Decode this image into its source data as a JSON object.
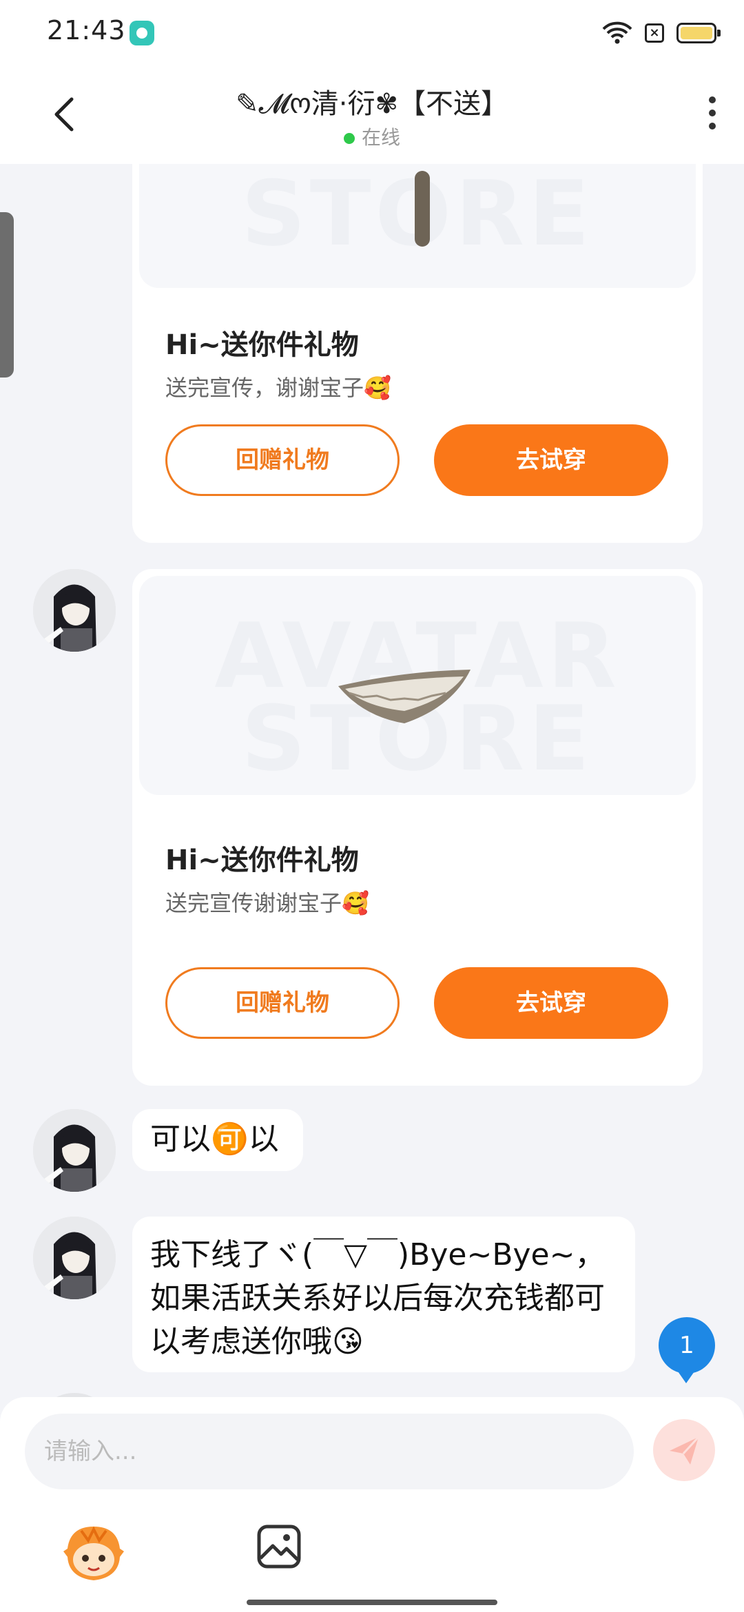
{
  "status_bar": {
    "time": "21:43"
  },
  "header": {
    "title": "✎𝓜ო清·衍✾【不送】",
    "status": "在线"
  },
  "messages": [
    {
      "type": "gift",
      "title": "Hi~送你件礼物",
      "subtitle": "送完宣传，谢谢宝子🥰",
      "reply_label": "回赠礼物",
      "try_label": "去试穿"
    },
    {
      "type": "gift",
      "title": "Hi~送你件礼物",
      "subtitle": "送完宣传谢谢宝子🥰",
      "reply_label": "回赠礼物",
      "try_label": "去试穿"
    },
    {
      "type": "text",
      "text": "可以🉑以"
    },
    {
      "type": "text",
      "text": "我下线了ヾ(￣▽￣)Bye~Bye~，如果活跃关系好以后每次充钱都可以考虑送你哦😘"
    }
  ],
  "unread_count": "1",
  "input": {
    "placeholder": "请输入..."
  },
  "colors": {
    "accent": "#fa7718",
    "online": "#2ec94a",
    "unread": "#1e88e5"
  }
}
